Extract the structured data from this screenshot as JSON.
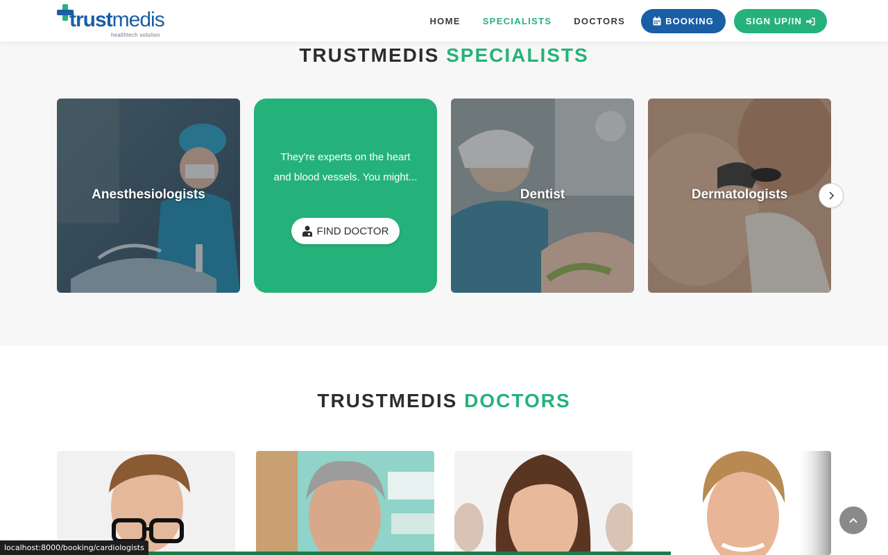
{
  "header": {
    "logo_text_bold": "trust",
    "logo_text_light": "medis",
    "logo_tagline": "healthtech solution",
    "nav": [
      {
        "label": "HOME",
        "active": false
      },
      {
        "label": "SPECIALISTS",
        "active": true
      },
      {
        "label": "DOCTORS",
        "active": false
      }
    ],
    "booking_label": "BOOKING",
    "signin_label": "SIGN UP/IN"
  },
  "specialists": {
    "title_prefix": "TRUSTMEDIS",
    "title_highlight": "SPECIALISTS",
    "cards": [
      {
        "label": "Anesthesiologists",
        "type": "image"
      },
      {
        "description": "They're experts on the heart and blood vessels. You might...",
        "button": "FIND DOCTOR",
        "type": "hover"
      },
      {
        "label": "Dentist",
        "type": "image"
      },
      {
        "label": "Dermatologists",
        "type": "image"
      }
    ],
    "next_icon": "chevron-right-icon"
  },
  "doctors": {
    "title_prefix": "TRUSTMEDIS",
    "title_highlight": "DOCTORS"
  },
  "status_url": "localhost:8000/booking/cardiologists",
  "colors": {
    "brand_blue": "#1a5ea6",
    "brand_green": "#25b27a"
  }
}
